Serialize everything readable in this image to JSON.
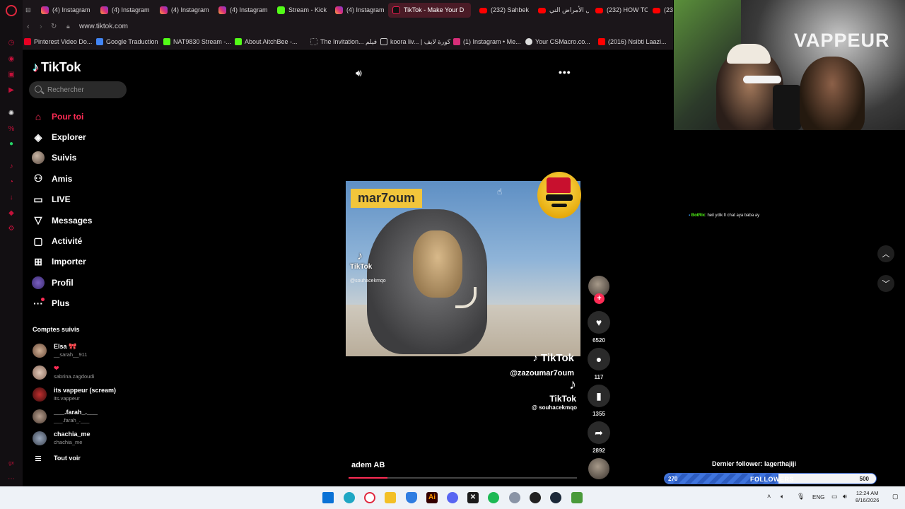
{
  "browser": {
    "tabs": [
      {
        "label": "(4) Instagram",
        "icon": "instagram-icon"
      },
      {
        "label": "(4) Instagram",
        "icon": "instagram-icon"
      },
      {
        "label": "(4) Instagram",
        "icon": "instagram-icon"
      },
      {
        "label": "(4) Instagram",
        "icon": "instagram-icon"
      },
      {
        "label": "Stream - Kick",
        "icon": "kick-icon"
      },
      {
        "label": "(4) Instagram",
        "icon": "instagram-icon"
      },
      {
        "label": "TikTok - Make Your D",
        "icon": "tiktok-icon"
      },
      {
        "label": "(232) Sahbek",
        "icon": "youtube-icon"
      },
      {
        "label": "كل الأمراض التي",
        "icon": "youtube-icon"
      },
      {
        "label": "(232) HOW TO",
        "icon": "youtube-icon"
      },
      {
        "label": "(232",
        "icon": "youtube-icon"
      }
    ],
    "url": "www.tiktok.com",
    "bookmarks": [
      {
        "label": "Pinterest Video Do...",
        "color": "#e60023"
      },
      {
        "label": "Google Traduction",
        "color": "#4285f4"
      },
      {
        "label": "NAT9830 Stream -...",
        "color": "#53fc18"
      },
      {
        "label": "About AitchBee -...",
        "color": "#53fc18"
      },
      {
        "label": "The Invitation... فيلم",
        "color": "#888888"
      },
      {
        "label": "koora liv... | كورة لايف",
        "color": "#cccccc"
      },
      {
        "label": "(1) Instagram • Me...",
        "color": "#d82e79"
      },
      {
        "label": "Your CSMacro.co...",
        "color": "#dddddd"
      },
      {
        "label": "(2016) Nsibti Laazi...",
        "color": "#ff0000"
      }
    ]
  },
  "tiktok": {
    "brand": "TikTok",
    "search_placeholder": "Rechercher",
    "nav": [
      {
        "label": "Pour toi",
        "icon": "home-icon"
      },
      {
        "label": "Explorer",
        "icon": "compass-icon"
      },
      {
        "label": "Suivis",
        "icon": "avatar"
      },
      {
        "label": "Amis",
        "icon": "friends-icon"
      },
      {
        "label": "LIVE",
        "icon": "live-icon"
      },
      {
        "label": "Messages",
        "icon": "messages-icon"
      },
      {
        "label": "Activité",
        "icon": "activity-icon"
      },
      {
        "label": "Importer",
        "icon": "upload-icon"
      },
      {
        "label": "Profil",
        "icon": "profile-icon"
      },
      {
        "label": "Plus",
        "icon": "more-icon"
      }
    ],
    "following_title": "Comptes suivis",
    "following": [
      {
        "name": "Elsa 🎀",
        "user": "__sarah__911",
        "color": "#b08a72"
      },
      {
        "name": "❤",
        "user": "sabrina.zagdoudi",
        "color": "#c4a896"
      },
      {
        "name": "its vappeur (scream)",
        "user": "its.vappeur",
        "color": "#8a2a2a"
      },
      {
        "name": "___.farah_.___",
        "user": "___.farah_.___",
        "color": "#9c8170"
      },
      {
        "name": "chachia_me",
        "user": "chachia_me",
        "color": "#7e8a9c"
      }
    ],
    "see_all": "Tout voir",
    "video": {
      "overlay_text": "mar7oum",
      "watermark": "TikTok",
      "watermark_user_1": "@souhacekmqo",
      "watermark_big_user": "@zazoumar7oum",
      "watermark_user_2": "@ souhacekmqo",
      "author": "adem AB",
      "progress": 0.17
    },
    "actions": {
      "likes": "6520",
      "comments": "117",
      "saves": "1355",
      "shares": "2892"
    }
  },
  "stream": {
    "webcam_sign": "VAPPEUR",
    "chat": {
      "name": "BotRix",
      "message": ": heil ydik fi chat aya baba ay"
    },
    "goal_title": "Dernier follower: lagerthajiji",
    "goal_label": "FOLLOWERS",
    "goal_current": "270",
    "goal_max": "500",
    "goal_fraction": 0.54
  },
  "taskbar": {
    "lang": "ENG",
    "time": "12:24 AM",
    "date": "8/16/2026"
  }
}
